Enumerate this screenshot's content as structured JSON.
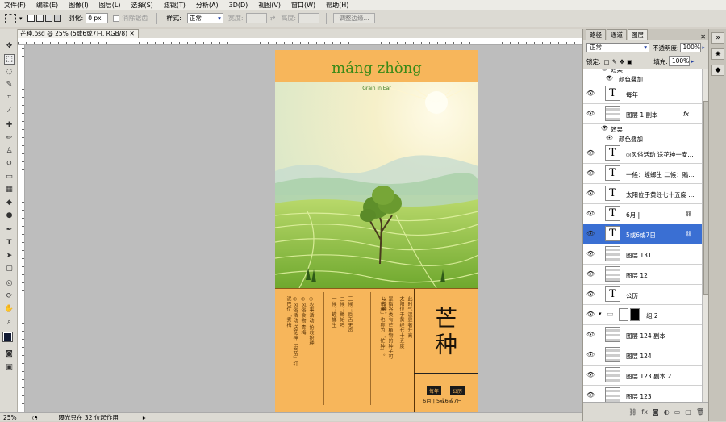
{
  "menu": [
    "文件(F)",
    "编辑(E)",
    "图像(I)",
    "图层(L)",
    "选择(S)",
    "滤镜(T)",
    "分析(A)",
    "3D(D)",
    "视图(V)",
    "窗口(W)",
    "帮助(H)"
  ],
  "options": {
    "feather_label": "羽化:",
    "feather_value": "0 px",
    "antialias_label": "消除锯齿",
    "style_label": "样式:",
    "style_value": "正常",
    "width_label": "宽度:",
    "height_label": "高度:",
    "refine_label": "调整边缘..."
  },
  "document_tab": "芒种.psd @ 25% (5或6或7日, RGB/8)",
  "doc": {
    "title": "máng zhòng",
    "subtitle": "Grain in Ear",
    "col1": "◎风俗活动 送花神「安苗」打泥巴仗「煮梅",
    "col2": "◎风俗食物 青梅",
    "col3": "◎农事活动 抢收抢种",
    "col4": "一候：螳螂生",
    "col5": "二候：鵙始鸣",
    "col6": "三候：反舌无声",
    "col7": "「芒种」也称为「忙种」。",
    "col8": "是指谷类有芒植物的种子可以播种。",
    "col9": "太阳位于黄经七十五度",
    "col10": "此时气温显著升高",
    "big_chars": "芒种",
    "badge1": "每年",
    "badge2": "公历",
    "date_line": "6月 | 5或6或7日"
  },
  "status": {
    "zoom": "25%",
    "info": "曝光只在 32 位起作用"
  },
  "panel": {
    "tabs": [
      "路径",
      "通道",
      "图层"
    ],
    "blend_mode": "正常",
    "opacity_label": "不透明度:",
    "opacity_value": "100%",
    "lock_label": "锁定:",
    "fill_label": "填充:",
    "fill_value": "100%"
  },
  "layers": [
    {
      "kind": "sub",
      "name": "效果"
    },
    {
      "kind": "sub2",
      "name": "颜色叠加"
    },
    {
      "kind": "text",
      "name": "每年"
    },
    {
      "kind": "pixel",
      "name": "图层 1 副本",
      "fx": "fx"
    },
    {
      "kind": "sub",
      "name": "效果"
    },
    {
      "kind": "sub2",
      "name": "颜色叠加"
    },
    {
      "kind": "text",
      "name": "◎风俗活动 送花神一安..."
    },
    {
      "kind": "text",
      "name": "一候：螳螂生 二候：鵙..."
    },
    {
      "kind": "text",
      "name": "太阳位于黄经七十五度 ..."
    },
    {
      "kind": "text",
      "name": "6月 |",
      "link": true
    },
    {
      "kind": "text",
      "name": "5或6或7日",
      "link": true,
      "selected": true
    },
    {
      "kind": "pixel",
      "name": "图层 131"
    },
    {
      "kind": "pixel",
      "name": "图层 12"
    },
    {
      "kind": "text",
      "name": "公历"
    },
    {
      "kind": "group",
      "name": "组 2"
    },
    {
      "kind": "pixel",
      "name": "图层 124 副本"
    },
    {
      "kind": "pixel",
      "name": "图层 124"
    },
    {
      "kind": "pixel",
      "name": "图层 123 副本 2"
    },
    {
      "kind": "pixel",
      "name": "图层 123"
    }
  ],
  "colors": {
    "canvas_bg": "#f7b65b",
    "title_green": "#3a8a17",
    "selection": "#3a6fd3"
  }
}
